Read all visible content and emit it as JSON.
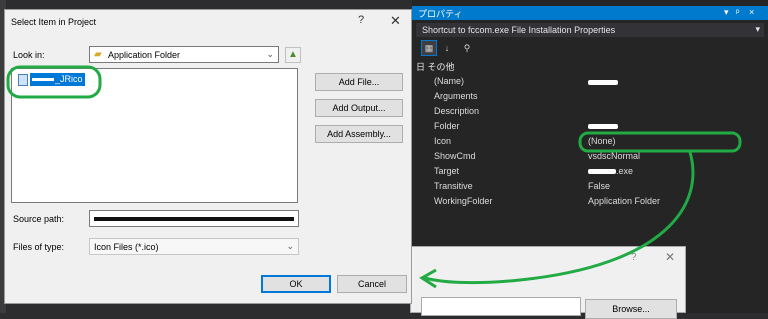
{
  "properties": {
    "panel_title": "プロパティ",
    "title_controls": [
      "▾",
      "ᵖ",
      "×"
    ],
    "object_selector": "Shortcut to fccom.exe  File Installation Properties",
    "category": "日 その他",
    "rows": [
      {
        "name": "(Name)",
        "value": ""
      },
      {
        "name": "Arguments",
        "value": ""
      },
      {
        "name": "Description",
        "value": ""
      },
      {
        "name": "Folder",
        "value": ""
      },
      {
        "name": "Icon",
        "value": "(None)"
      },
      {
        "name": "ShowCmd",
        "value": "vsdscNormal"
      },
      {
        "name": "Target",
        "value": ".exe"
      },
      {
        "name": "Transitive",
        "value": "False"
      },
      {
        "name": "WorkingFolder",
        "value": "Application Folder"
      }
    ]
  },
  "dialog": {
    "title": "Select Item in Project",
    "help": "?",
    "close": "✕",
    "look_in_label": "Look in:",
    "look_in_value": "Application Folder",
    "list_item": "_JRico",
    "add_file": "Add File...",
    "add_output": "Add Output...",
    "add_assembly": "Add Assembly...",
    "source_path_label": "Source path:",
    "files_of_type_label": "Files of type:",
    "files_of_type_value": "Icon Files (*.ico)",
    "ok": "OK",
    "cancel": "Cancel"
  },
  "background_dialog": {
    "help": "?",
    "close": "✕",
    "browse": "Browse..."
  },
  "colors": {
    "accent": "#007acc",
    "annotation": "#22aa44",
    "selection": "#0078d7"
  }
}
